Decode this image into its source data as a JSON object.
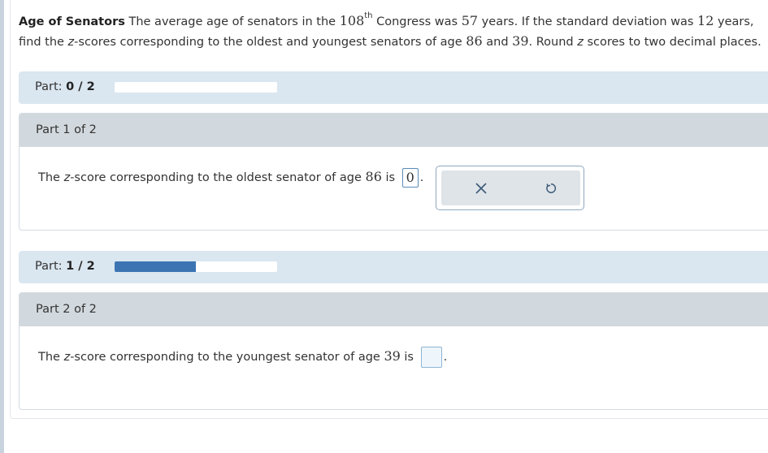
{
  "problem": {
    "title": "Age of Senators",
    "text_1": " The average age of senators in the ",
    "congress_num": "108",
    "congress_sup": "th",
    "text_2": " Congress was ",
    "mean": "57",
    "text_3": " years. If the standard deviation was ",
    "sd": "12",
    "text_4": " years, find the ",
    "z1": "z",
    "text_5": "-scores corresponding to the oldest and youngest senators of age ",
    "age_old": "86",
    "text_6": " and ",
    "age_young": "39",
    "text_7": ". Round ",
    "z2": "z",
    "text_8": " scores to two decimal places."
  },
  "part1": {
    "bar_label": "Part:",
    "bar_value": "0 / 2",
    "progress": 0.0,
    "heading": "Part 1 of 2",
    "q_pre": "The ",
    "q_z": "z",
    "q_mid": "-score corresponding to the oldest senator of age ",
    "q_age": "86",
    "q_is": " is",
    "answer": "0",
    "period": "."
  },
  "part2": {
    "bar_label": "Part:",
    "bar_value": "1 / 2",
    "progress": 0.5,
    "heading": "Part 2 of 2",
    "q_pre": "The ",
    "q_z": "z",
    "q_mid": "-score corresponding to the youngest senator of age ",
    "q_age": "39",
    "q_is": " is",
    "answer": "",
    "period": "."
  },
  "toolbar": {
    "clear_icon": "close-icon",
    "reset_icon": "undo-icon"
  },
  "colors": {
    "progress_fill": "#3c74b3",
    "part_bar_bg": "#dae6f0",
    "part_head_bg": "#d2d9de"
  }
}
